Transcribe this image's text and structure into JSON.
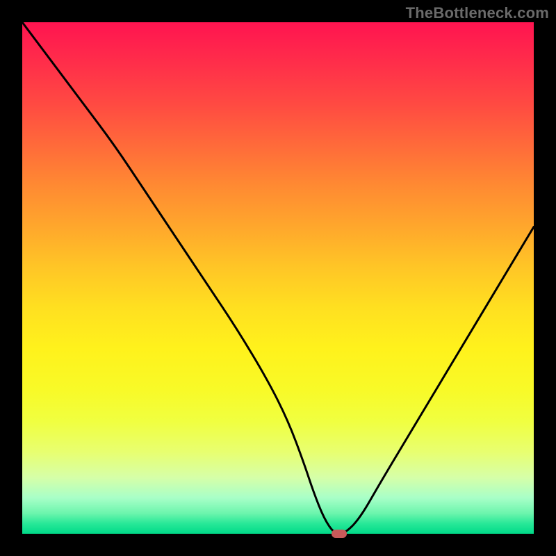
{
  "attribution": "TheBottleneck.com",
  "chart_data": {
    "type": "line",
    "title": "",
    "xlabel": "",
    "ylabel": "",
    "xlim": [
      0,
      100
    ],
    "ylim": [
      0,
      100
    ],
    "grid": false,
    "series": [
      {
        "name": "bottleneck-curve",
        "x": [
          0,
          6,
          12,
          18,
          24,
          30,
          36,
          42,
          48,
          52,
          55,
          57,
          59,
          61,
          63,
          66,
          70,
          76,
          82,
          88,
          94,
          100
        ],
        "y": [
          100,
          92,
          84,
          76,
          67,
          58,
          49,
          40,
          30,
          22,
          14,
          8,
          3,
          0,
          0,
          3,
          10,
          20,
          30,
          40,
          50,
          60
        ]
      }
    ],
    "marker": {
      "x": 62,
      "y": 0
    },
    "background_gradient": {
      "top": "#ff1450",
      "mid": "#ffe020",
      "bottom": "#00da88"
    }
  }
}
